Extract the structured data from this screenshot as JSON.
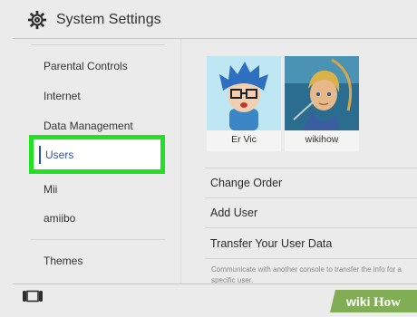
{
  "header": {
    "title": "System Settings",
    "icon": "gear-icon"
  },
  "sidebar": {
    "items": [
      {
        "label": "Parental Controls"
      },
      {
        "label": "Internet"
      },
      {
        "label": "Data Management"
      },
      {
        "label": "Users",
        "selected": true
      },
      {
        "label": "Mii"
      },
      {
        "label": "amiibo"
      },
      {
        "label": "Themes"
      }
    ]
  },
  "users": [
    {
      "name": "Er Vic",
      "avatar": "mii-avatar"
    },
    {
      "name": "wikihow",
      "avatar": "link-avatar"
    }
  ],
  "options": [
    {
      "label": "Change Order"
    },
    {
      "label": "Add User"
    },
    {
      "label": "Transfer Your User Data"
    }
  ],
  "transfer_description": "Communicate with another console to transfer the info for a specific user.",
  "footer": {
    "icon": "console-icon"
  },
  "watermark": {
    "prefix": "wiki",
    "suffix": "How"
  },
  "colors": {
    "highlight_border": "#22e022",
    "selected_text": "#2b4dbd",
    "background": "#ebebeb"
  }
}
